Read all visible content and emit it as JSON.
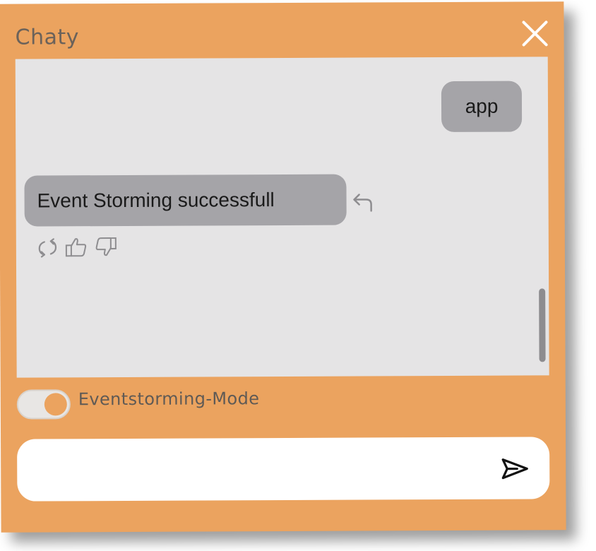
{
  "window": {
    "title": "Chaty"
  },
  "messages": [
    {
      "role": "user",
      "text": "app"
    },
    {
      "role": "bot",
      "text": "Event Storming successfull"
    }
  ],
  "actions": {
    "reply_icon": "reply-arrow-icon",
    "regenerate_icon": "regenerate-icon",
    "thumbs_up_icon": "thumbs-up-icon",
    "thumbs_down_icon": "thumbs-down-icon"
  },
  "mode_toggle": {
    "label": "Eventstorming-Mode",
    "enabled": true
  },
  "composer": {
    "value": "",
    "placeholder": "",
    "send_icon": "send-icon"
  },
  "colors": {
    "window_background": "#eba35f",
    "message_area": "#e5e4e5",
    "bubble": "#a5a4a8",
    "title_text": "#6b625a"
  }
}
